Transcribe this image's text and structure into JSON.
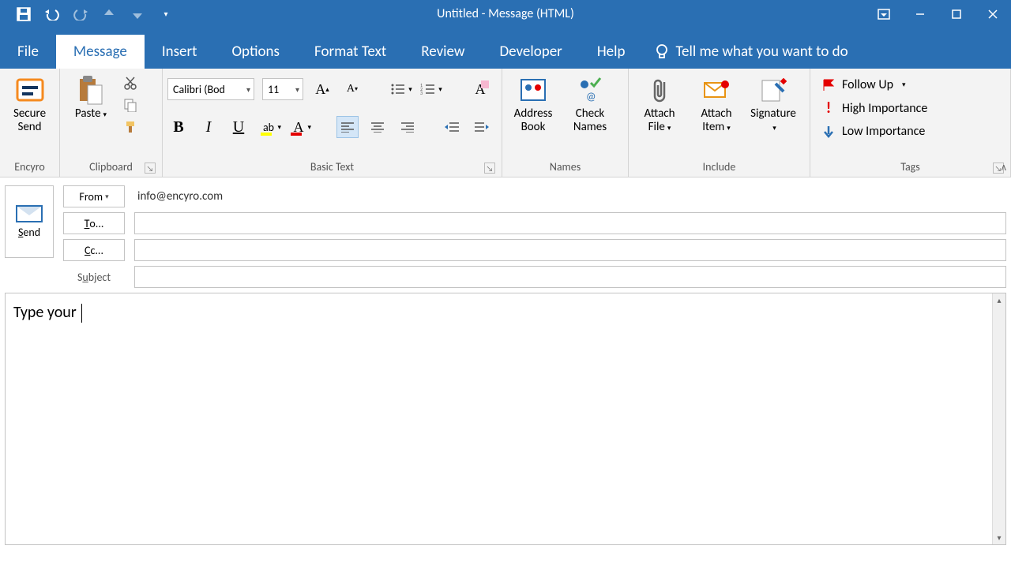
{
  "window": {
    "title": "Untitled  -  Message (HTML)"
  },
  "tabs": {
    "file": "File",
    "message": "Message",
    "insert": "Insert",
    "options": "Options",
    "format_text": "Format Text",
    "review": "Review",
    "developer": "Developer",
    "help": "Help",
    "tellme": "Tell me what you want to do"
  },
  "ribbon": {
    "encyro": {
      "btn": "Secure Send",
      "label": "Encyro"
    },
    "clipboard": {
      "paste": "Paste",
      "label": "Clipboard"
    },
    "basic_text": {
      "font_name": "Calibri (Bod",
      "font_size": "11",
      "label": "Basic Text"
    },
    "names": {
      "address": "Address Book",
      "check": "Check Names",
      "label": "Names"
    },
    "include": {
      "attach_file": "Attach File",
      "attach_item": "Attach Item",
      "signature": "Signature",
      "label": "Include"
    },
    "tags": {
      "follow": "Follow Up",
      "high": "High Importance",
      "low": "Low Importance",
      "label": "Tags"
    }
  },
  "fields": {
    "send": "Send",
    "from_btn": "From",
    "from_value": "info@encyro.com",
    "to_btn": "To...",
    "cc_btn": "Cc...",
    "subject_label": "Subject",
    "to_value": "",
    "cc_value": "",
    "subject_value": ""
  },
  "body": {
    "text": "Type your "
  }
}
